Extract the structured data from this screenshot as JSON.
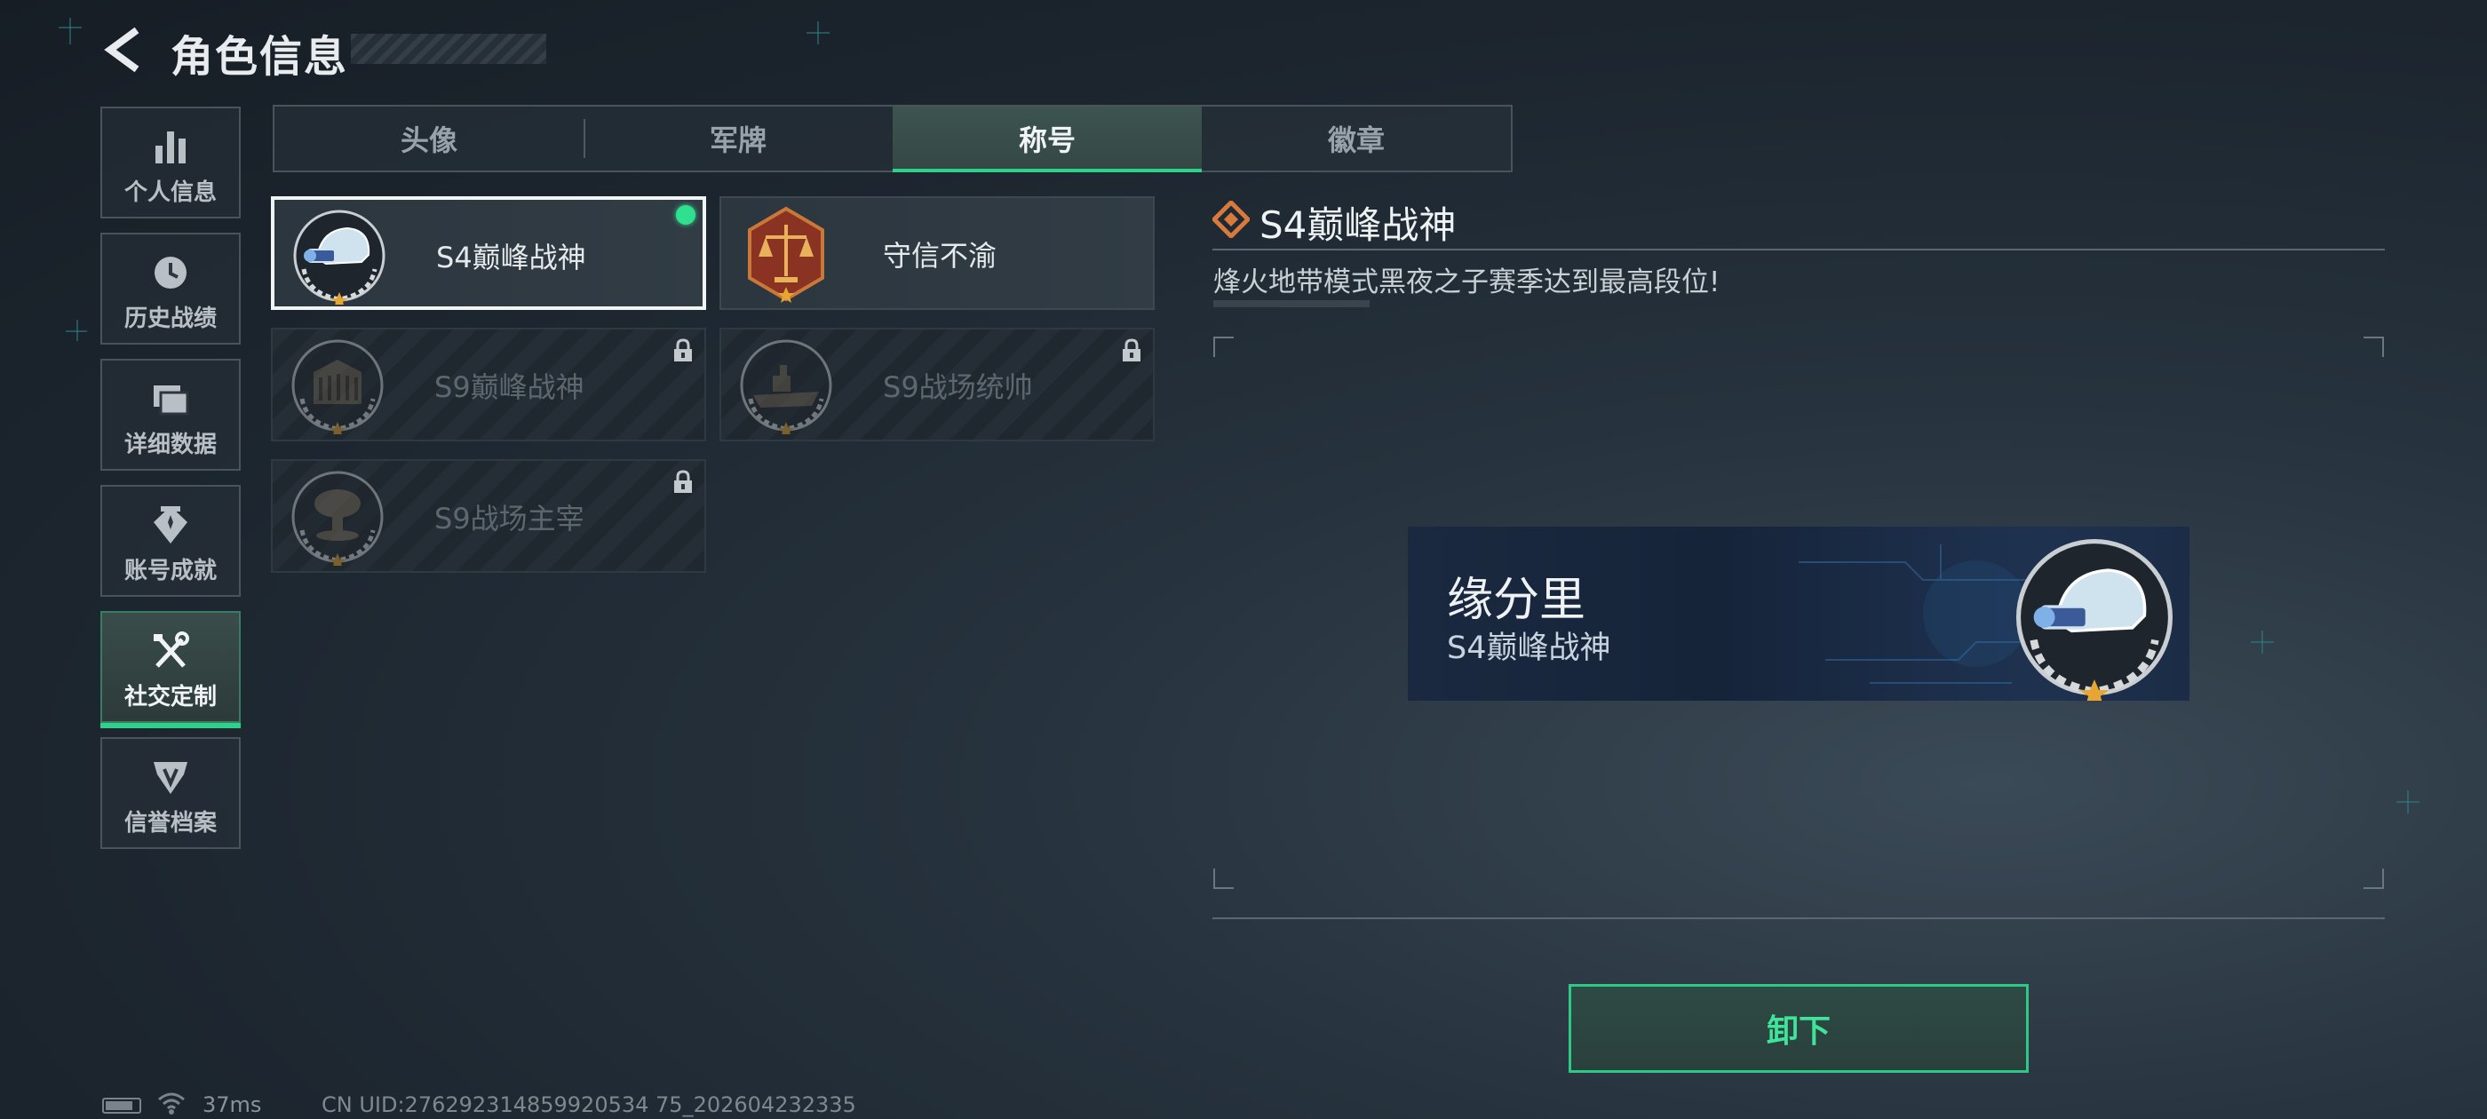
{
  "header": {
    "title": "角色信息"
  },
  "sidebar": {
    "items": [
      {
        "label": "个人信息",
        "icon": "bar-chart-icon"
      },
      {
        "label": "历史战绩",
        "icon": "clock-icon"
      },
      {
        "label": "详细数据",
        "icon": "folders-icon"
      },
      {
        "label": "账号成就",
        "icon": "achievement-icon"
      },
      {
        "label": "社交定制",
        "icon": "tools-icon",
        "active": true
      },
      {
        "label": "信誉档案",
        "icon": "shield-v-icon"
      }
    ]
  },
  "tabs": [
    {
      "label": "头像"
    },
    {
      "label": "军牌"
    },
    {
      "label": "称号",
      "active": true
    },
    {
      "label": "徽章"
    }
  ],
  "titles": [
    {
      "name": "S4巅峰战神",
      "icon": "helmet-nightvision-icon",
      "selected": true,
      "equipped": true,
      "locked": false
    },
    {
      "name": "守信不渝",
      "icon": "scales-of-justice-icon",
      "selected": false,
      "equipped": false,
      "locked": false
    },
    {
      "name": "S9巅峰战神",
      "icon": "building-icon",
      "selected": false,
      "equipped": false,
      "locked": true
    },
    {
      "name": "S9战场统帅",
      "icon": "warship-icon",
      "selected": false,
      "equipped": false,
      "locked": true
    },
    {
      "name": "S9战场主宰",
      "icon": "mushroom-cloud-icon",
      "selected": false,
      "equipped": false,
      "locked": true
    }
  ],
  "detail": {
    "title": "S4巅峰战神",
    "description": "烽火地带模式黑夜之子赛季达到最高段位!",
    "preview": {
      "player_name": "缘分里",
      "title": "S4巅峰战神"
    }
  },
  "actions": {
    "unequip_label": "卸下"
  },
  "status": {
    "ping": "37ms",
    "uid": "CN UID:276292314859920534 75_202604232335"
  },
  "colors": {
    "accent": "#2fd08a",
    "background": "#1c252e",
    "title_orange": "#d87a3c"
  }
}
